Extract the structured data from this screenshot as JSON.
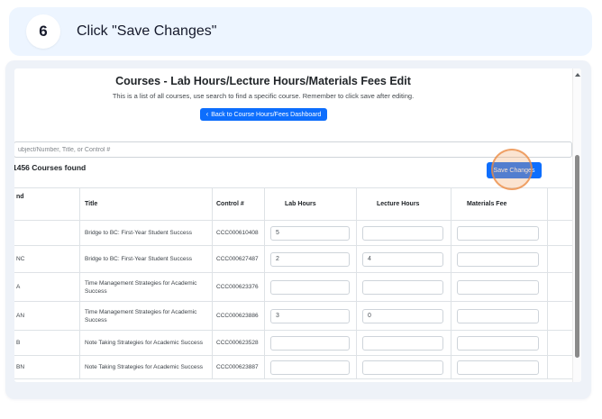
{
  "step": {
    "number": "6",
    "title": "Click \"Save Changes\""
  },
  "screenshot": {
    "heading": "Courses - Lab Hours/Lecture Hours/Materials Fees Edit",
    "subheading": "This is a list of all courses, use search to find a specific course. Remember to click save after editing.",
    "back_button": {
      "chevron": "‹",
      "label": "Back to Course Hours/Fees Dashboard"
    },
    "search": {
      "placeholder": "ubject/Number, Title, or Control #"
    },
    "results_count": "1456 Courses found",
    "save_button": "Save Changes",
    "table": {
      "headers": {
        "col1": "nd",
        "title": "Title",
        "control": "Control #",
        "lab": "Lab Hours",
        "lecture": "Lecture Hours",
        "materials": "Materials Fee"
      },
      "rows": [
        {
          "col1": "",
          "title": "Bridge to BC: First-Year Student Success",
          "control": "CCC000610408",
          "lab": "5",
          "lecture": "",
          "materials": ""
        },
        {
          "col1": "NC",
          "title": "Bridge to BC: First-Year Student Success",
          "control": "CCC000627487",
          "lab": "2",
          "lecture": "4",
          "materials": ""
        },
        {
          "col1": "A",
          "title": "Time Management Strategies for Academic Success",
          "control": "CCC000623376",
          "lab": "",
          "lecture": "",
          "materials": ""
        },
        {
          "col1": "AN",
          "title": "Time Management Strategies for Academic Success",
          "control": "CCC000623886",
          "lab": "3",
          "lecture": "0",
          "materials": ""
        },
        {
          "col1": "B",
          "title": "Note Taking Strategies for Academic Success",
          "control": "CCC000623528",
          "lab": "",
          "lecture": "",
          "materials": ""
        },
        {
          "col1": "BN",
          "title": "Note Taking Strategies for Academic Success",
          "control": "CCC000623887",
          "lab": "",
          "lecture": "",
          "materials": ""
        }
      ]
    },
    "icons": {
      "scroll_up": "up-triangle",
      "back_chevron": "left-chevron"
    }
  },
  "colors": {
    "accent_blue": "#0d6efd",
    "banner_bg": "#edf5ff",
    "frame_bg": "#eef2f8",
    "highlight_orange": "#eb8a42",
    "scroll_thumb": "#8a8a8a"
  }
}
